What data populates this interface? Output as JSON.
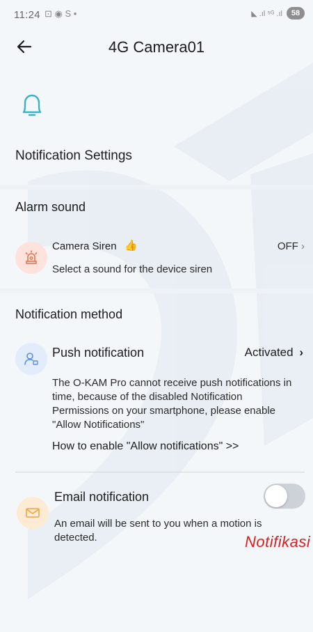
{
  "status_bar": {
    "time": "11:24",
    "left_icons": "⊡ ◉ S •",
    "right_icons": "◣ .ıl ⁵ᴳ .ıl",
    "battery": "58"
  },
  "header": {
    "title": "4G Camera01"
  },
  "notification_settings": {
    "title": "Notification Settings"
  },
  "alarm_sound": {
    "section_label": "Alarm sound",
    "camera_siren": {
      "title": "Camera Siren",
      "description": "Select a sound for the device siren",
      "value": "OFF"
    }
  },
  "notification_method": {
    "section_label": "Notification method",
    "push": {
      "title": "Push notification",
      "value": "Activated",
      "warning": "The O-KAM Pro cannot receive push notifications in time, because of the disabled Notification Permissions on your smartphone, please enable \"Allow Notifications\"",
      "help_link": "How to enable \"Allow notifications\" >>"
    },
    "email": {
      "title": "Email notification",
      "description": "An email will be sent to you when a motion is detected.",
      "enabled": false
    }
  },
  "overlay_text": "Notifikasi",
  "colors": {
    "accent_teal": "#3fb1c7",
    "siren_bg": "#fde3dc",
    "push_bg": "#e3ecfb",
    "email_bg": "#fdebd4",
    "red_overlay": "#e21b1b"
  }
}
